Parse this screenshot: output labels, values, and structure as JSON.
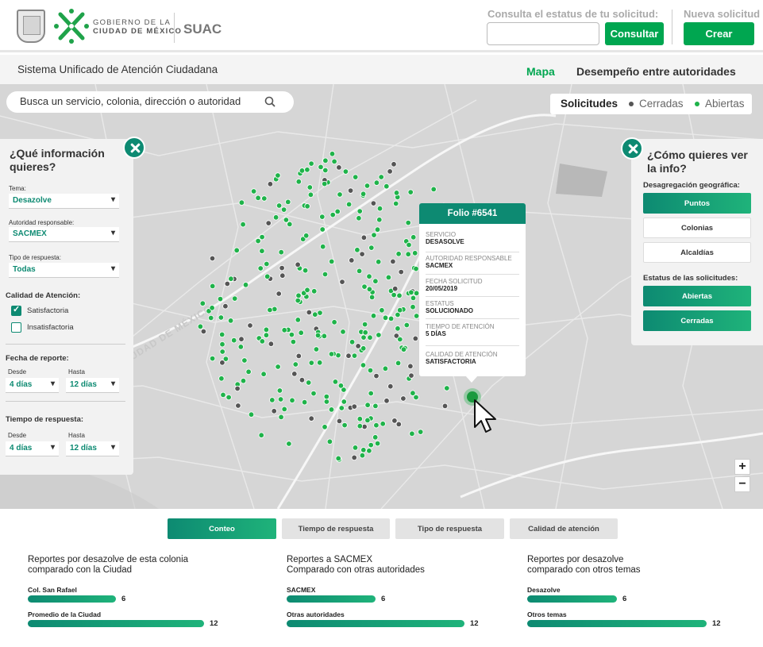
{
  "header": {
    "gov_line1": "GOBIERNO DE LA",
    "gov_line2": "CIUDAD DE MÉXICO",
    "app_name": "SUAC",
    "status_label": "Consulta el estatus de tu solicitud:",
    "status_input_value": "",
    "consult_button": "Consultar",
    "new_label": "Nueva solicitud",
    "create_button": "Crear"
  },
  "subheader": {
    "title": "Sistema Unificado de Atención Ciudadana",
    "nav": [
      "Mapa",
      "Desempeño entre autoridades"
    ],
    "active_nav": "Mapa"
  },
  "map": {
    "search_placeholder": "Busca un servicio, colonia, dirección o autoridad",
    "legend_title": "Solicitudes",
    "legend_closed": "Cerradas",
    "legend_open": "Abiertas",
    "closed_color": "#555555",
    "open_color": "#1fb34a",
    "road_label": "CIUDAD DE MÉXICO",
    "zoom_in": "+",
    "zoom_out": "−"
  },
  "left_panel": {
    "title": "¿Qué información quieres?",
    "tema_label": "Tema:",
    "tema_value": "Desazolve",
    "autoridad_label": "Autoridad responsable:",
    "autoridad_value": "SACMEX",
    "tipo_label": "Tipo de respuesta:",
    "tipo_value": "Todas",
    "calidad_label": "Calidad de Atención:",
    "calidad_options": [
      {
        "label": "Satisfactoria",
        "checked": true
      },
      {
        "label": "Insatisfactoria",
        "checked": false
      }
    ],
    "fecha_label": "Fecha de reporte:",
    "fecha_desde_label": "Desde",
    "fecha_desde_value": "4 días",
    "fecha_hasta_label": "Hasta",
    "fecha_hasta_value": "12 días",
    "tiempo_label": "Tiempo de respuesta:",
    "tiempo_desde_label": "Desde",
    "tiempo_desde_value": "4 días",
    "tiempo_hasta_label": "Hasta",
    "tiempo_hasta_value": "12 días"
  },
  "right_panel": {
    "title": "¿Cómo quieres ver la info?",
    "geo_label": "Desagregación geográfica:",
    "geo_options": [
      "Puntos",
      "Colonias",
      "Alcaldías"
    ],
    "geo_active": "Puntos",
    "status_label": "Estatus de las solicitudes:",
    "status_options": [
      "Abiertas",
      "Cerradas"
    ]
  },
  "popup": {
    "title": "Folio #6541",
    "fields": [
      {
        "key": "SERVICIO",
        "value": "DESASOLVE"
      },
      {
        "key": "AUTORIDAD RESPONSABLE",
        "value": "SACMEX"
      },
      {
        "key": "FECHA SOLICITUD",
        "value": "20/05/2019"
      },
      {
        "key": "ESTATUS",
        "value": "SOLUCIONADO"
      },
      {
        "key": "TIEMPO DE ATENCIÓN",
        "value": "5 DÍAS"
      },
      {
        "key": "CALIDAD DE ATENCIÓN",
        "value": "SATISFACTORIA"
      }
    ]
  },
  "tabs": [
    "Conteo",
    "Tiempo de respuesta",
    "Tipo de respuesta",
    "Calidad de atención"
  ],
  "active_tab": "Conteo",
  "stats": [
    {
      "title_line1": "Reportes por desazolve de esta colonia",
      "title_line2": "comparado con la Ciudad",
      "rows": [
        {
          "label": "Col. San Rafael",
          "value": 6
        },
        {
          "label": "Promedio de la  Ciudad",
          "value": 12
        }
      ]
    },
    {
      "title_line1": "Reportes a SACMEX",
      "title_line2": "Comparado con otras autoridades",
      "rows": [
        {
          "label": "SACMEX",
          "value": 6
        },
        {
          "label": "Otras autoridades",
          "value": 12
        }
      ]
    },
    {
      "title_line1": "Reportes por desazolve",
      "title_line2": "comparado con otros temas",
      "rows": [
        {
          "label": "Desazolve",
          "value": 6
        },
        {
          "label": "Otros temas",
          "value": 12
        }
      ]
    }
  ]
}
